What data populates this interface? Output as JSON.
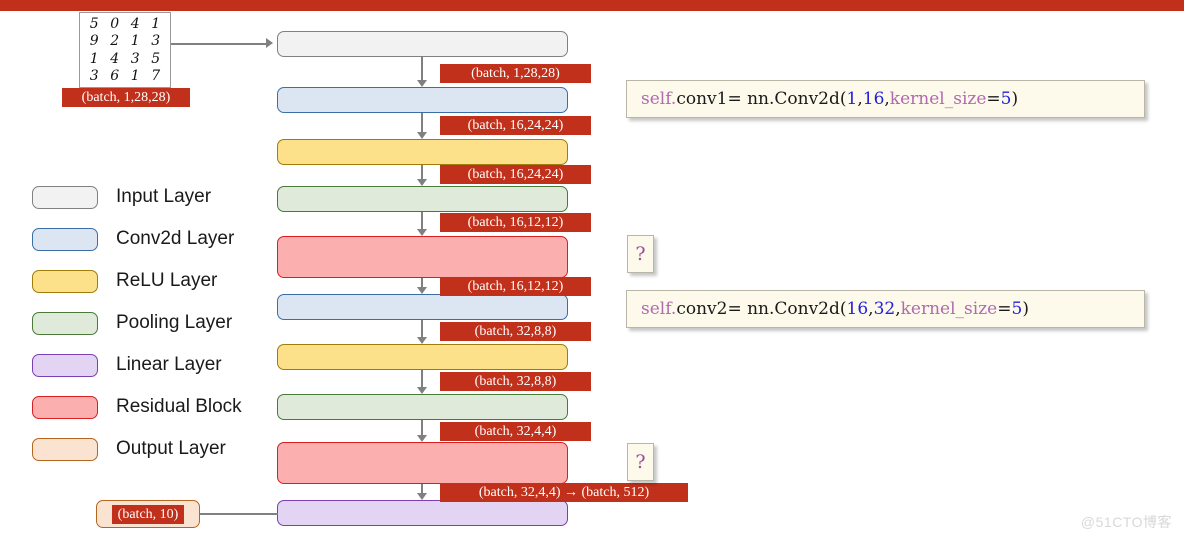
{
  "theme": {
    "accent_bar": "#c0301a",
    "tensor_label_bg": "#c0301a",
    "background": "#ffffff"
  },
  "mnist_sample": {
    "caption": "(batch, 1,28,28)",
    "rows": [
      [
        "5",
        "0",
        "4",
        "1"
      ],
      [
        "9",
        "2",
        "1",
        "3"
      ],
      [
        "1",
        "4",
        "3",
        "5"
      ],
      [
        "3",
        "6",
        "1",
        "7"
      ]
    ]
  },
  "legend": {
    "items": [
      {
        "label": "Input Layer",
        "fill": "#f2f2f2",
        "stroke": "#808080"
      },
      {
        "label": "Conv2d Layer",
        "fill": "#dce6f2",
        "stroke": "#3b6ea5"
      },
      {
        "label": "ReLU Layer",
        "fill": "#fce08a",
        "stroke": "#a07c0a"
      },
      {
        "label": "Pooling Layer",
        "fill": "#dfeada",
        "stroke": "#4a7a3a"
      },
      {
        "label": "Linear Layer",
        "fill": "#e2d4f2",
        "stroke": "#7a3fb5"
      },
      {
        "label": "Residual Block",
        "fill": "#fcafaf",
        "stroke": "#d92020"
      },
      {
        "label": "Output Layer",
        "fill": "#fbe3d2",
        "stroke": "#b5651d"
      }
    ]
  },
  "pipeline": {
    "blocks": [
      {
        "type": "Input Layer"
      },
      {
        "type": "Conv2d Layer"
      },
      {
        "type": "ReLU Layer"
      },
      {
        "type": "Pooling Layer"
      },
      {
        "type": "Residual Block"
      },
      {
        "type": "Conv2d Layer"
      },
      {
        "type": "ReLU Layer"
      },
      {
        "type": "Pooling Layer"
      },
      {
        "type": "Residual Block"
      },
      {
        "type": "Linear Layer"
      }
    ],
    "tensor_labels": [
      "(batch, 1,28,28)",
      "(batch, 16,24,24)",
      "(batch, 16,24,24)",
      "(batch, 16,12,12)",
      "(batch, 16,12,12)",
      "(batch, 32,8,8)",
      "(batch, 32,8,8)",
      "(batch, 32,4,4)",
      "(batch, 32,4,4) → (batch, 512)"
    ],
    "output_label": "(batch, 10)"
  },
  "code_callouts": [
    {
      "self": "self.",
      "attr": "conv1",
      "assign": " = nn.Conv2d(",
      "arg1": "1",
      "sep1": ",  ",
      "arg2": "16",
      "sep2": ",  ",
      "kwarg": "kernel_size",
      "eq": "=",
      "arg3": "5",
      "close": ")"
    },
    {
      "self": "self.",
      "attr": "conv2",
      "assign": " = nn.Conv2d(",
      "arg1": "16",
      "sep1": ",  ",
      "arg2": "32",
      "sep2": ",  ",
      "kwarg": "kernel_size",
      "eq": "=",
      "arg3": "5",
      "close": ")"
    }
  ],
  "question_cards": [
    {
      "text": "?"
    },
    {
      "text": "?"
    }
  ],
  "watermark": "@51CTO博客"
}
